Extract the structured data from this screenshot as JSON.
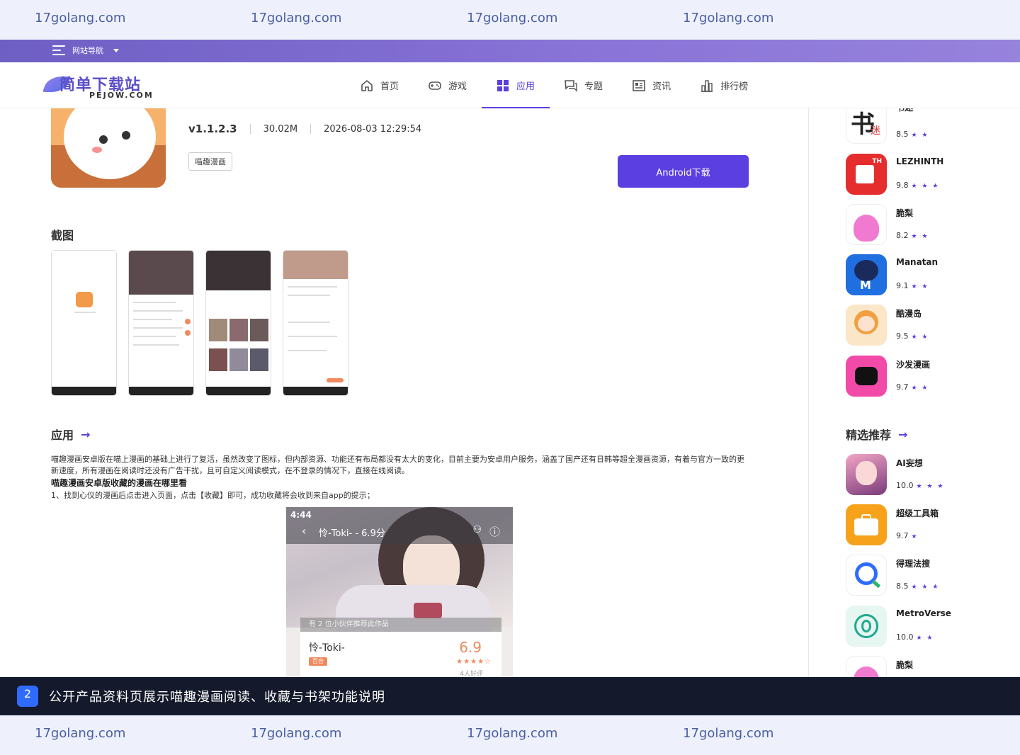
{
  "watermark": {
    "text": "17golang.com"
  },
  "site_nav": {
    "label": "网站导航"
  },
  "logo": {
    "cn": "简单下载站",
    "en": "PEJOW.COM"
  },
  "nav": [
    {
      "label": "首页",
      "icon": "home-icon"
    },
    {
      "label": "游戏",
      "icon": "gamepad-icon"
    },
    {
      "label": "应用",
      "icon": "grid-icon",
      "active": true
    },
    {
      "label": "专题",
      "icon": "chat-icon"
    },
    {
      "label": "资讯",
      "icon": "news-icon"
    },
    {
      "label": "排行榜",
      "icon": "chart-icon"
    }
  ],
  "app": {
    "version": "v1.1.2.3",
    "size": "30.02M",
    "updated": "2026-08-03 12:29:54",
    "tag": "喵趣漫画",
    "download_label": "Android下载"
  },
  "screenshots": {
    "title": "截图"
  },
  "app_section": {
    "title": "应用",
    "description": "喵趣漫画安卓版在喵上漫画的基础上进行了复活，虽然改变了图标，但内部资源、功能还有布局都没有太大的变化，目前主要为安卓用户服务，涵盖了国产还有日韩等超全漫画资源，有着与官方一致的更新速度，所有漫画在阅读时还没有广告干扰，且可自定义阅读模式，在不登录的情况下，直接在线阅读。",
    "subheading": "喵趣漫画安卓版收藏的漫画在哪里看",
    "step1": "1、找到心仪的漫画后点击进入页面，点击【收藏】即可，成功收藏将会收到来自app的提示；"
  },
  "phone_preview": {
    "time": "4:44",
    "title": "怜-Toki- - 6.9分",
    "recommend": "有 2 位小伙伴推荐此作品",
    "work_title": "怜-Toki-",
    "genre": "百合",
    "score": "6.9",
    "reviews": "4人好评"
  },
  "sidebar_top": [
    {
      "name": "书迷",
      "score": "8.5",
      "stars": "★ ★",
      "icon": "shumi-icon"
    },
    {
      "name": "LEZHINTH",
      "score": "9.8",
      "stars": "★ ★ ★",
      "icon": "lezhin-icon"
    },
    {
      "name": "脆梨",
      "score": "8.2",
      "stars": "★ ★",
      "icon": "cuili-icon"
    },
    {
      "name": "Manatan",
      "score": "9.1",
      "stars": "★ ★",
      "icon": "manatan-icon"
    },
    {
      "name": "酷漫岛",
      "score": "9.5",
      "stars": "★ ★",
      "icon": "kumandao-icon"
    },
    {
      "name": "沙发漫画",
      "score": "9.7",
      "stars": "★ ★",
      "icon": "shafa-icon"
    }
  ],
  "featured": {
    "title": "精选推荐",
    "items": [
      {
        "name": "AI妄想",
        "score": "10.0",
        "stars": "★ ★ ★",
        "icon": "ai-wangxiang-icon"
      },
      {
        "name": "超级工具箱",
        "score": "9.7",
        "stars": "★",
        "icon": "toolbox-icon"
      },
      {
        "name": "得理法搜",
        "score": "8.5",
        "stars": "★ ★ ★",
        "icon": "delifasou-icon"
      },
      {
        "name": "MetroVerse",
        "score": "10.0",
        "stars": "★ ★",
        "icon": "metroverse-icon"
      },
      {
        "name": "脆梨",
        "score": "",
        "stars": "",
        "icon": "cuili-icon"
      }
    ]
  },
  "caption": {
    "number": "2",
    "text": "公开产品资料页展示喵趣漫画阅读、收藏与书架功能说明"
  }
}
